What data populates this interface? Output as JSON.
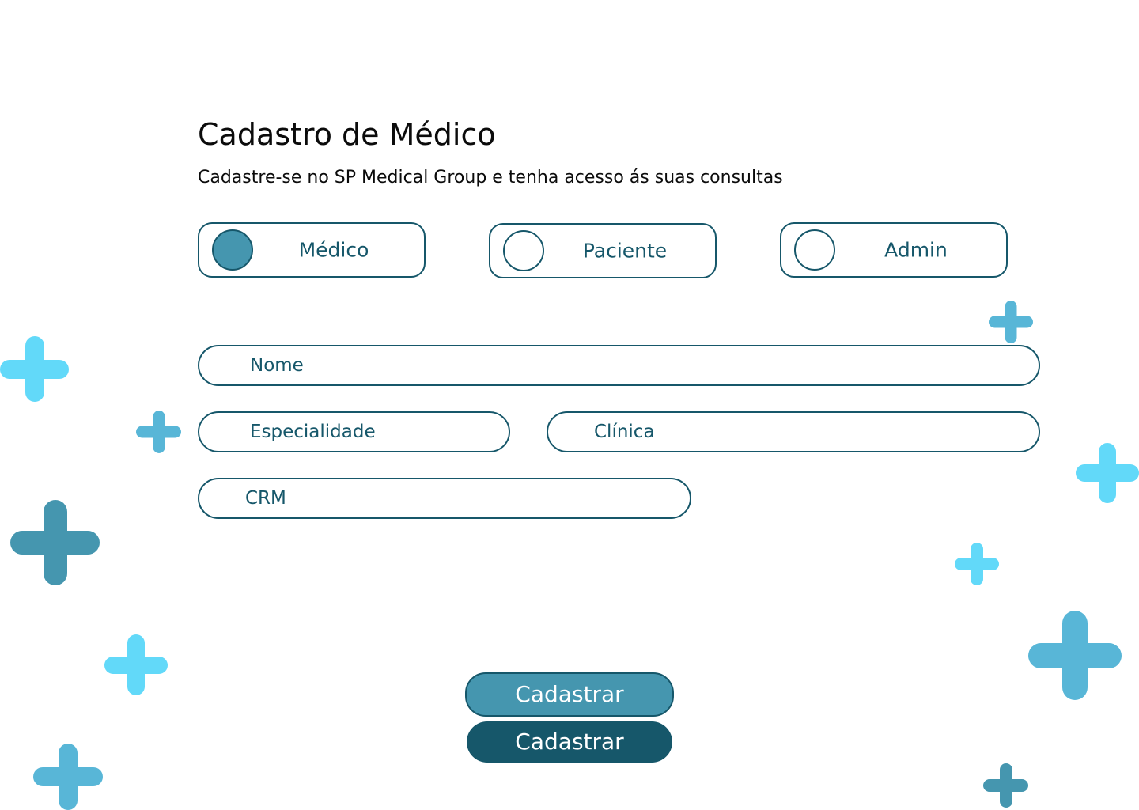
{
  "header": {
    "title": "Cadastro de Médico",
    "subtitle": "Cadastre-se no SP Medical Group e tenha acesso ás suas consultas"
  },
  "roles": [
    {
      "label": "Médico",
      "selected": true
    },
    {
      "label": "Paciente",
      "selected": false
    },
    {
      "label": "Admin",
      "selected": false
    }
  ],
  "form": {
    "nome_placeholder": "Nome",
    "especialidade_placeholder": "Especialidade",
    "clinica_placeholder": "Clínica",
    "crm_placeholder": "CRM"
  },
  "actions": {
    "primary_label": "Cadastrar",
    "secondary_label": "Cadastrar"
  },
  "colors": {
    "primary_dark": "#16576a",
    "primary": "#4596af",
    "accent_light": "#62d9f9",
    "accent_mid": "#58b6d7"
  },
  "decorations": {
    "icon": "plus-icon"
  }
}
